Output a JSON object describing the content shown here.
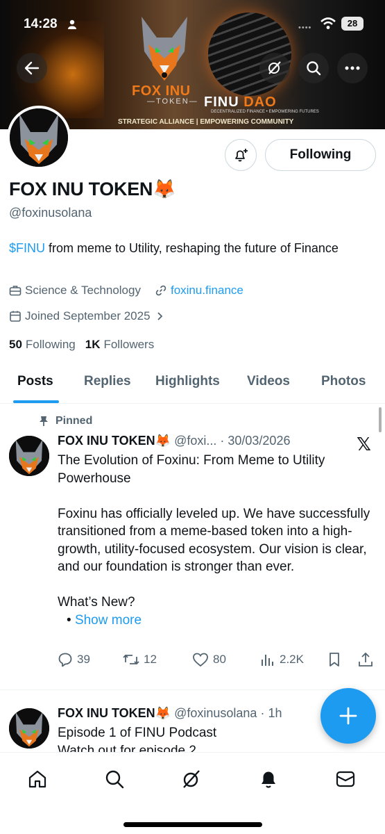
{
  "status_bar": {
    "time": "14:28",
    "battery": "28"
  },
  "banner": {
    "fox_brand": "FOX INU",
    "fox_sub": "—TOKEN—",
    "finu_brand_1": "FINU",
    "finu_brand_2": "DAO",
    "finu_sub": "DECENTRALIZED FINANCE • EMPOWERING FUTURES",
    "tagline": "STRATEGIC ALLIANCE | EMPOWERING COMMUNITY"
  },
  "profile": {
    "name": "FOX INU TOKEN🦊",
    "handle": "@foxinusolana",
    "bio_cashtag": "$FINU",
    "bio_rest": " from meme to Utility, reshaping the future of Finance",
    "category": "Science & Technology",
    "website": "foxinu.finance",
    "joined": "Joined September 2025",
    "following_count": "50",
    "following_label": "Following",
    "followers_count": "1K",
    "followers_label": "Followers",
    "follow_button": "Following"
  },
  "tabs": [
    "Posts",
    "Replies",
    "Highlights",
    "Videos",
    "Photos"
  ],
  "pinned_post": {
    "pinned_label": "Pinned",
    "name": "FOX INU TOKEN🦊",
    "handle_date": " @foxi... · 30/03/2026",
    "line1": "The Evolution of Foxinu: From Meme to Utility Powerhouse",
    "line2": "Foxinu has officially leveled up. We have successfully transitioned from a meme-based token into a high-growth, utility-focused ecosystem. Our vision is clear, and our foundation is stronger than ever.",
    "line3": "What’s New?",
    "bullet": "•",
    "show_more": "Show more",
    "replies": "39",
    "reposts": "12",
    "likes": "80",
    "views": "2.2K",
    "x_logo": "𝕏"
  },
  "second_post": {
    "name": "FOX INU TOKEN🦊",
    "handle_time": " @foxinusolana · 1h",
    "line1": "Episode 1 of FINU Podcast",
    "line2": "Watch out for episode 2"
  },
  "colors": {
    "accent": "#1d9bf0",
    "muted": "#536471",
    "text": "#0f1419"
  },
  "icons": {
    "back": "arrow-left-icon",
    "grok": "grok-icon",
    "search": "search-icon",
    "more": "more-icon",
    "notify": "bell-plus-icon",
    "briefcase": "briefcase-icon",
    "link": "link-icon",
    "calendar": "calendar-icon",
    "pin": "pin-icon",
    "reply": "reply-icon",
    "repost": "repost-icon",
    "like": "heart-icon",
    "views": "views-icon",
    "bookmark": "bookmark-icon",
    "share": "share-icon",
    "compose": "plus-icon",
    "nav": [
      "home-icon",
      "search-icon",
      "grok-icon",
      "bell-icon",
      "mail-icon"
    ]
  }
}
